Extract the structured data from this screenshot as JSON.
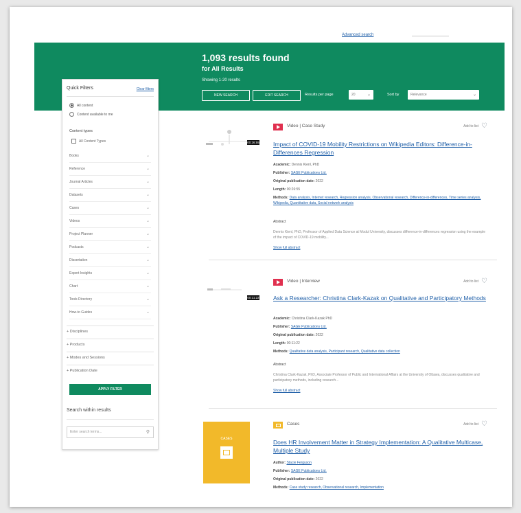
{
  "header": {
    "top_link": "Advanced search"
  },
  "banner": {
    "results_count": "1,093 results found",
    "scope": "for All Results",
    "showing": "Showing 1-20 results",
    "new_search": "NEW SEARCH",
    "edit_search": "EDIT SEARCH",
    "results_per_page_label": "Results per page",
    "results_per_page_value": "20",
    "sort_by_label": "Sort by",
    "sort_by_value": "Relevance"
  },
  "quick_filters": {
    "title": "Quick Filters",
    "clear": "Clear filters",
    "radios": [
      {
        "label": "All content",
        "selected": true
      },
      {
        "label": "Content available to me",
        "selected": false
      }
    ],
    "content_types_label": "Content types",
    "all_content_types": "All Content Types",
    "types": [
      "Books",
      "Reference",
      "Journal Articles",
      "Datasets",
      "Cases",
      "Videos",
      "Project Planner",
      "Podcasts",
      "Dissertation",
      "Expert Insights",
      "Chart",
      "Tools Directory",
      "How-to Guides"
    ],
    "groups": [
      "Disciplines",
      "Products",
      "Modes and Sessions",
      "Publication Date"
    ],
    "apply": "APPLY FILTER",
    "search_within_label": "Search within results",
    "search_placeholder": "Enter search terms..."
  },
  "results": [
    {
      "type": "Video | Case Study",
      "add_to_list": "Add to list",
      "title": "Impact of COVID-19 Mobility Restrictions on Wikipedia Editors: Difference-in-Differences Regression",
      "duration": "00:26:55",
      "academic_label": "Academic:",
      "academic": "Dennis Kienl, PhD",
      "publisher_label": "Publisher:",
      "publisher": "SAGE Publications Ltd.",
      "pubdate_label": "Original publication date:",
      "pubdate": "2022",
      "length_label": "Length:",
      "length": "00:26:55",
      "methods_label": "Methods:",
      "methods": "Data analysis, Internet research, Regression analysis, Observational research, Difference-in-differences, Time series analysis, Wikipedia, Quantitative data, Social network analysis",
      "abstract_label": "Abstract",
      "abstract": "Dennis Kienl, PhD, Professor of Applied Data Science at Modul University, discusses difference-in-differences regression using the example of the impact of COVID-19 mobility...",
      "show_abstract": "Show full abstract"
    },
    {
      "type": "Video | Interview",
      "add_to_list": "Add to list",
      "title": "Ask a Researcher: Christina Clark-Kazak on Qualitative and Participatory Methods",
      "duration": "00:11:22",
      "academic_label": "Academic:",
      "academic": "Christina Clark-Kazak PhD",
      "publisher_label": "Publisher:",
      "publisher": "SAGE Publications Ltd.",
      "pubdate_label": "Original publication date:",
      "pubdate": "2022",
      "length_label": "Length:",
      "length": "00:11:22",
      "methods_label": "Methods:",
      "methods": "Qualitative data analysis, Participant research, Qualitative data collection",
      "abstract_label": "Abstract",
      "abstract": "Christina Clark-Kazak, PhD, Associate Professor of Public and International Affairs at the University of Ottawa, discusses qualitative and participatory methods, including research...",
      "show_abstract": "Show full abstract"
    },
    {
      "type": "Cases",
      "add_to_list": "Add to list",
      "thumb_label": "CASES",
      "title": "Does HR Involvement Matter in Strategy Implementation: A Qualitative Multicase, Multiple Study",
      "author_label": "Author:",
      "author": "Stacie Ferguson",
      "publisher_label": "Publisher:",
      "publisher": "SAGE Publications Ltd.",
      "pubdate_label": "Original publication date:",
      "pubdate": "2022",
      "methods_label": "Methods:",
      "methods": "Case study research, Observational research, Implementation"
    }
  ],
  "colors": {
    "brand_green": "#0f8a5f",
    "link_blue": "#1f5fa8",
    "video_red": "#e0304f",
    "case_yellow": "#f2b92a"
  }
}
